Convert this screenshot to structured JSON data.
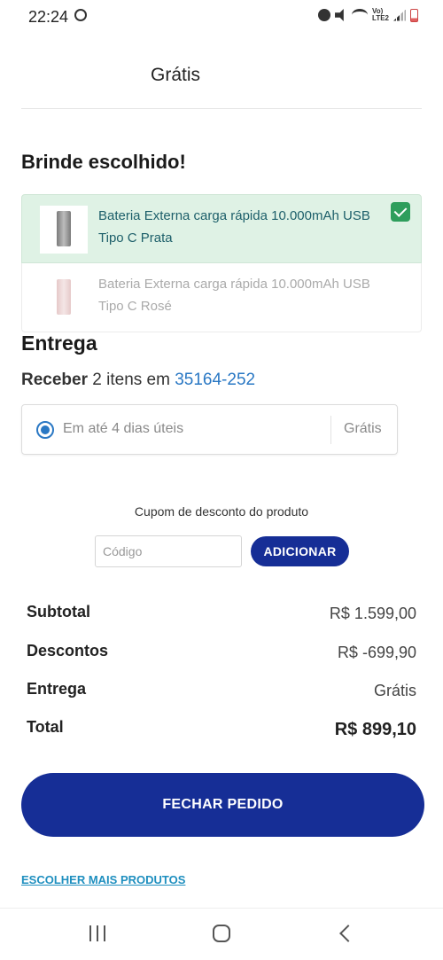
{
  "status_bar": {
    "time": "22:24",
    "lte_label": "Vo)\nLTE2",
    "icons": [
      "sync-icon",
      "alarm-icon",
      "mute-icon",
      "wifi-icon",
      "lte-icon",
      "signal-icon",
      "battery-icon"
    ]
  },
  "header": {
    "gratis": "Grátis"
  },
  "gift": {
    "title": "Brinde escolhido!",
    "options": [
      {
        "label": "Bateria Externa carga rápida 10.000mAh USB Tipo C Prata",
        "selected": true
      },
      {
        "label": "Bateria Externa carga rápida 10.000mAh USB Tipo C Rosé",
        "selected": false
      }
    ]
  },
  "delivery": {
    "title": "Entrega",
    "receber_label": "Receber",
    "items_text": " 2 itens em ",
    "cep": "35164-252",
    "option": {
      "label": "Em até 4 dias úteis",
      "price": "Grátis",
      "selected": true
    }
  },
  "coupon": {
    "label": "Cupom de desconto do produto",
    "placeholder": "Código",
    "value": "",
    "button": "ADICIONAR"
  },
  "summary": {
    "subtotal_label": "Subtotal",
    "subtotal_value": "R$ 1.599,00",
    "discount_label": "Descontos",
    "discount_value": "R$ -699,90",
    "shipping_label": "Entrega",
    "shipping_value": "Grátis",
    "total_label": "Total",
    "total_value": "R$ 899,10"
  },
  "actions": {
    "close_order": "FECHAR PEDIDO",
    "more_products": "ESCOLHER MAIS PRODUTOS"
  },
  "colors": {
    "primary": "#162e96",
    "link": "#2a78c4",
    "selected_bg": "#dff2e5",
    "check": "#2e9e5c"
  }
}
